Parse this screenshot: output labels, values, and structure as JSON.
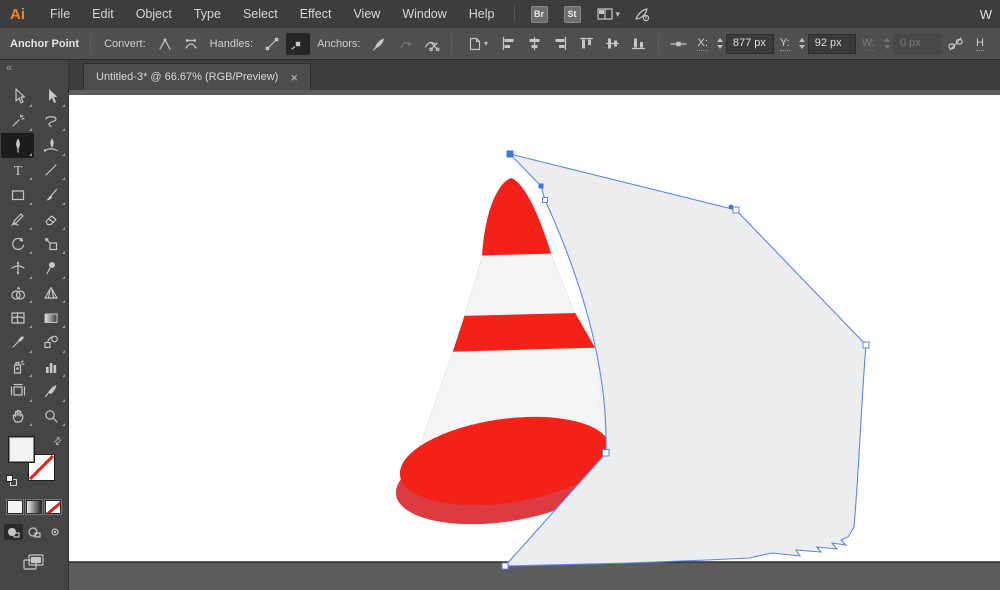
{
  "menubar": {
    "logo": "Ai",
    "items": [
      "File",
      "Edit",
      "Object",
      "Type",
      "Select",
      "Effect",
      "View",
      "Window",
      "Help"
    ],
    "bridge_label": "Br",
    "stock_label": "St",
    "workspace_chevron": "▾",
    "truncated_text": "W"
  },
  "controlbar": {
    "context_label": "Anchor Point",
    "convert_label": "Convert:",
    "handles_label": "Handles:",
    "anchors_label": "Anchors:",
    "doc_chevron": "▾",
    "x_label": "X:",
    "x_value": "877 px",
    "y_label": "Y:",
    "y_value": "92 px",
    "w_label": "W:",
    "w_value": "0 px",
    "h_label": "H"
  },
  "tabbar": {
    "title": "Untitled-3* @ 66.67% (RGB/Preview)",
    "close": "×"
  },
  "toolbar": {
    "collapse": "«",
    "swap_glyph": "⇄"
  },
  "artwork": {
    "cone_red": "#f42119",
    "base_side_red": "#dc3b41",
    "cone_white": "#f3f4f6",
    "polygon_fill": "#ecedef",
    "path_blue": "#5b86e8",
    "anchor_fill": "#3f76e8",
    "artboard_white": "#ffffff",
    "pasteboard_gray": "#5c5c5c"
  }
}
